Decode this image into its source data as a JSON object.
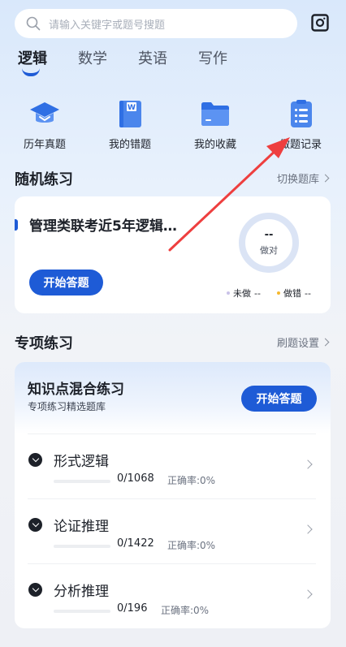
{
  "search": {
    "placeholder": "请输入关键字或题号搜题",
    "search_icon": "search-icon",
    "scan_icon": "scan-icon"
  },
  "tabs": [
    {
      "label": "逻辑",
      "active": true
    },
    {
      "label": "数学",
      "active": false
    },
    {
      "label": "英语",
      "active": false
    },
    {
      "label": "写作",
      "active": false
    }
  ],
  "quick_entries": [
    {
      "label": "历年真题",
      "icon": "graduation-cap-icon"
    },
    {
      "label": "我的错题",
      "icon": "notebook-icon"
    },
    {
      "label": "我的收藏",
      "icon": "folder-icon"
    },
    {
      "label": "做题记录",
      "icon": "record-list-icon"
    }
  ],
  "random_practice": {
    "title": "随机练习",
    "switch_link": "切换题库",
    "bank_name": "管理类联考近5年逻辑…",
    "start_button": "开始答题",
    "correct_value": "--",
    "correct_label": "做对",
    "legend": [
      {
        "dot": "•",
        "label": "未做",
        "value": "--",
        "color": "#c9c2e8"
      },
      {
        "dot": "•",
        "label": "做错",
        "value": "--",
        "color": "#f5b82e"
      }
    ]
  },
  "special_practice": {
    "title": "专项练习",
    "settings_link": "刷题设置",
    "mixed_title": "知识点混合练习",
    "mixed_subtitle": "专项练习精选题库",
    "start_button": "开始答题",
    "accuracy_prefix": "正确率:",
    "categories": [
      {
        "name": "形式逻辑",
        "progress": "0/1068",
        "accuracy": "0%",
        "fill": 0
      },
      {
        "name": "论证推理",
        "progress": "0/1422",
        "accuracy": "0%",
        "fill": 0
      },
      {
        "name": "分析推理",
        "progress": "0/196",
        "accuracy": "0%",
        "fill": 0
      }
    ]
  },
  "colors": {
    "accent": "#1e5bd6",
    "annotation_arrow": "#ee3f3f"
  }
}
